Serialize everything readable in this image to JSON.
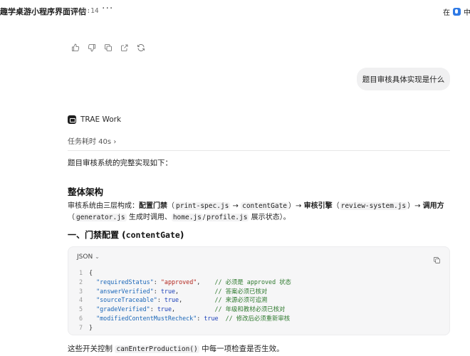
{
  "header": {
    "title": "趣学桌游小程序界面评估",
    "time": "00:14",
    "more": "···",
    "right_text_1": "在",
    "right_text_2": "中"
  },
  "actions": [
    "thumbs-up",
    "thumbs-down",
    "copy",
    "share",
    "refresh"
  ],
  "user_message": "题目审核具体实现是什么",
  "agent": {
    "name": "TRAE Work",
    "task_label": "任务耗时 40s",
    "task_chevron": "›"
  },
  "content": {
    "intro": "题目审核系统的完整实现如下：",
    "heading_arch": "整体架构",
    "arch": {
      "t1": "审核系统由三层构成：",
      "b1": "配置门禁",
      "t2": "（",
      "c1": "print-spec.js",
      "t3": " → ",
      "c2": "contentGate",
      "t4": "）→ ",
      "b2": "审核引擎",
      "t5": "（",
      "c3": "review-system.js",
      "t6": "）→ ",
      "b3": "调用方",
      "t7": "（",
      "c4": "generator.js",
      "t8": " 生成时调用、",
      "c5": "home.js",
      "t9": "/",
      "c6": "profile.js",
      "t10": " 展示状态）。"
    },
    "heading_gate_prefix": "一、门禁配置 (",
    "heading_gate_code": "contentGate",
    "heading_gate_suffix": ")",
    "footer": {
      "t1": "这些开关控制 ",
      "code": "canEnterProduction()",
      "t2": " 中每一项检查是否生效。"
    }
  },
  "code_block": {
    "language": "JSON",
    "lang_chevron": "⌄",
    "lines": [
      {
        "no": "1",
        "parts": [
          {
            "t": "{",
            "c": ""
          }
        ]
      },
      {
        "no": "2",
        "parts": [
          {
            "t": "  \"requiredStatus\"",
            "c": "k"
          },
          {
            "t": ": ",
            "c": ""
          },
          {
            "t": "\"approved\"",
            "c": "s"
          },
          {
            "t": ",    ",
            "c": ""
          },
          {
            "t": "// 必须是 approved 状态",
            "c": "c"
          }
        ]
      },
      {
        "no": "3",
        "parts": [
          {
            "t": "  \"answerVerified\"",
            "c": "k"
          },
          {
            "t": ": ",
            "c": ""
          },
          {
            "t": "true",
            "c": "b"
          },
          {
            "t": ",          ",
            "c": ""
          },
          {
            "t": "// 答案必须已核对",
            "c": "c"
          }
        ]
      },
      {
        "no": "4",
        "parts": [
          {
            "t": "  \"sourceTraceable\"",
            "c": "k"
          },
          {
            "t": ": ",
            "c": ""
          },
          {
            "t": "true",
            "c": "b"
          },
          {
            "t": ",         ",
            "c": ""
          },
          {
            "t": "// 来源必须可追溯",
            "c": "c"
          }
        ]
      },
      {
        "no": "5",
        "parts": [
          {
            "t": "  \"gradeVerified\"",
            "c": "k"
          },
          {
            "t": ": ",
            "c": ""
          },
          {
            "t": "true",
            "c": "b"
          },
          {
            "t": ",           ",
            "c": ""
          },
          {
            "t": "// 年级和教材必须已核对",
            "c": "c"
          }
        ]
      },
      {
        "no": "6",
        "parts": [
          {
            "t": "  \"modifiedContentMustRecheck\"",
            "c": "k"
          },
          {
            "t": ": ",
            "c": ""
          },
          {
            "t": "true",
            "c": "b"
          },
          {
            "t": "  ",
            "c": ""
          },
          {
            "t": "// 修改后必须重新审核",
            "c": "c"
          }
        ]
      },
      {
        "no": "7",
        "parts": [
          {
            "t": "}",
            "c": ""
          }
        ]
      }
    ]
  }
}
